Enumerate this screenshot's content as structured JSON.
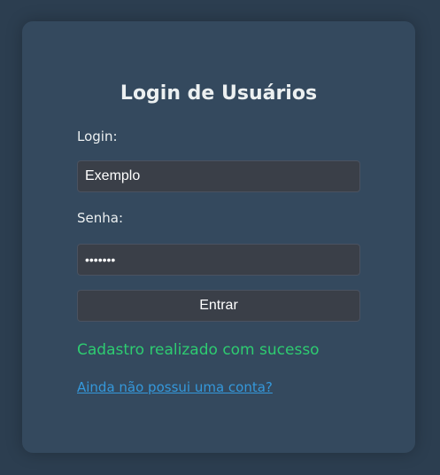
{
  "form": {
    "title": "Login de Usuários",
    "login_label": "Login:",
    "login_value": "Exemplo",
    "password_label": "Senha:",
    "password_value": "•••••••",
    "submit_label": "Entrar",
    "success_message": "Cadastro realizado com sucesso",
    "register_link": "Ainda não possui uma conta?"
  },
  "colors": {
    "page_background": "#2c3e50",
    "card_background": "#34495e",
    "input_background": "#3a3f48",
    "success": "#2ecc71",
    "link": "#3498db",
    "text": "#ecf0f1"
  }
}
